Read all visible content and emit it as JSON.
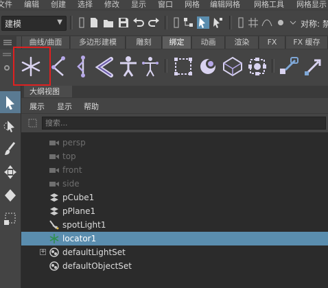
{
  "menubar": {
    "items": [
      "文件",
      "编辑",
      "创建",
      "选择",
      "修改",
      "显示",
      "窗口",
      "网格",
      "编辑网格",
      "网格工具",
      "网格显示"
    ]
  },
  "statusline": {
    "mode": "建模",
    "symmetry_label": "对称: 禁"
  },
  "shelf_tabs": {
    "items": [
      "",
      "曲线/曲面",
      "多边形建模",
      "雕刻",
      "绑定",
      "动画",
      "渲染",
      "FX",
      "FX 缓存"
    ],
    "active": "绑定"
  },
  "shelf": {
    "icons": [
      "locator-icon",
      "ik-handle-icon",
      "ik-spline-icon",
      "joint-icon",
      "skeleton-icon",
      "humanik-icon",
      "lattice-icon",
      "cluster-icon",
      "wrap-icon",
      "soft-mod-icon",
      "constraint-icon",
      "ik-arrow-icon"
    ],
    "highlight_color": "#e02020"
  },
  "panel": {
    "tab": "大纲视图",
    "menu": [
      "展示",
      "显示",
      "帮助"
    ],
    "search_placeholder": "搜索..."
  },
  "outliner": {
    "selected_color": "#5a8dae",
    "items": [
      {
        "label": "persp",
        "icon": "camera-icon",
        "dim": true
      },
      {
        "label": "top",
        "icon": "camera-icon",
        "dim": true
      },
      {
        "label": "front",
        "icon": "camera-icon",
        "dim": true
      },
      {
        "label": "side",
        "icon": "camera-icon",
        "dim": true
      },
      {
        "label": "pCube1",
        "icon": "mesh-icon",
        "dim": false
      },
      {
        "label": "pPlane1",
        "icon": "mesh-icon",
        "dim": false
      },
      {
        "label": "spotLight1",
        "icon": "spotlight-icon",
        "dim": false
      },
      {
        "label": "locator1",
        "icon": "locator-icon",
        "dim": false,
        "selected": true
      },
      {
        "label": "defaultLightSet",
        "icon": "set-icon",
        "dim": false,
        "expandable": true
      },
      {
        "label": "defaultObjectSet",
        "icon": "set-icon",
        "dim": false
      }
    ]
  }
}
